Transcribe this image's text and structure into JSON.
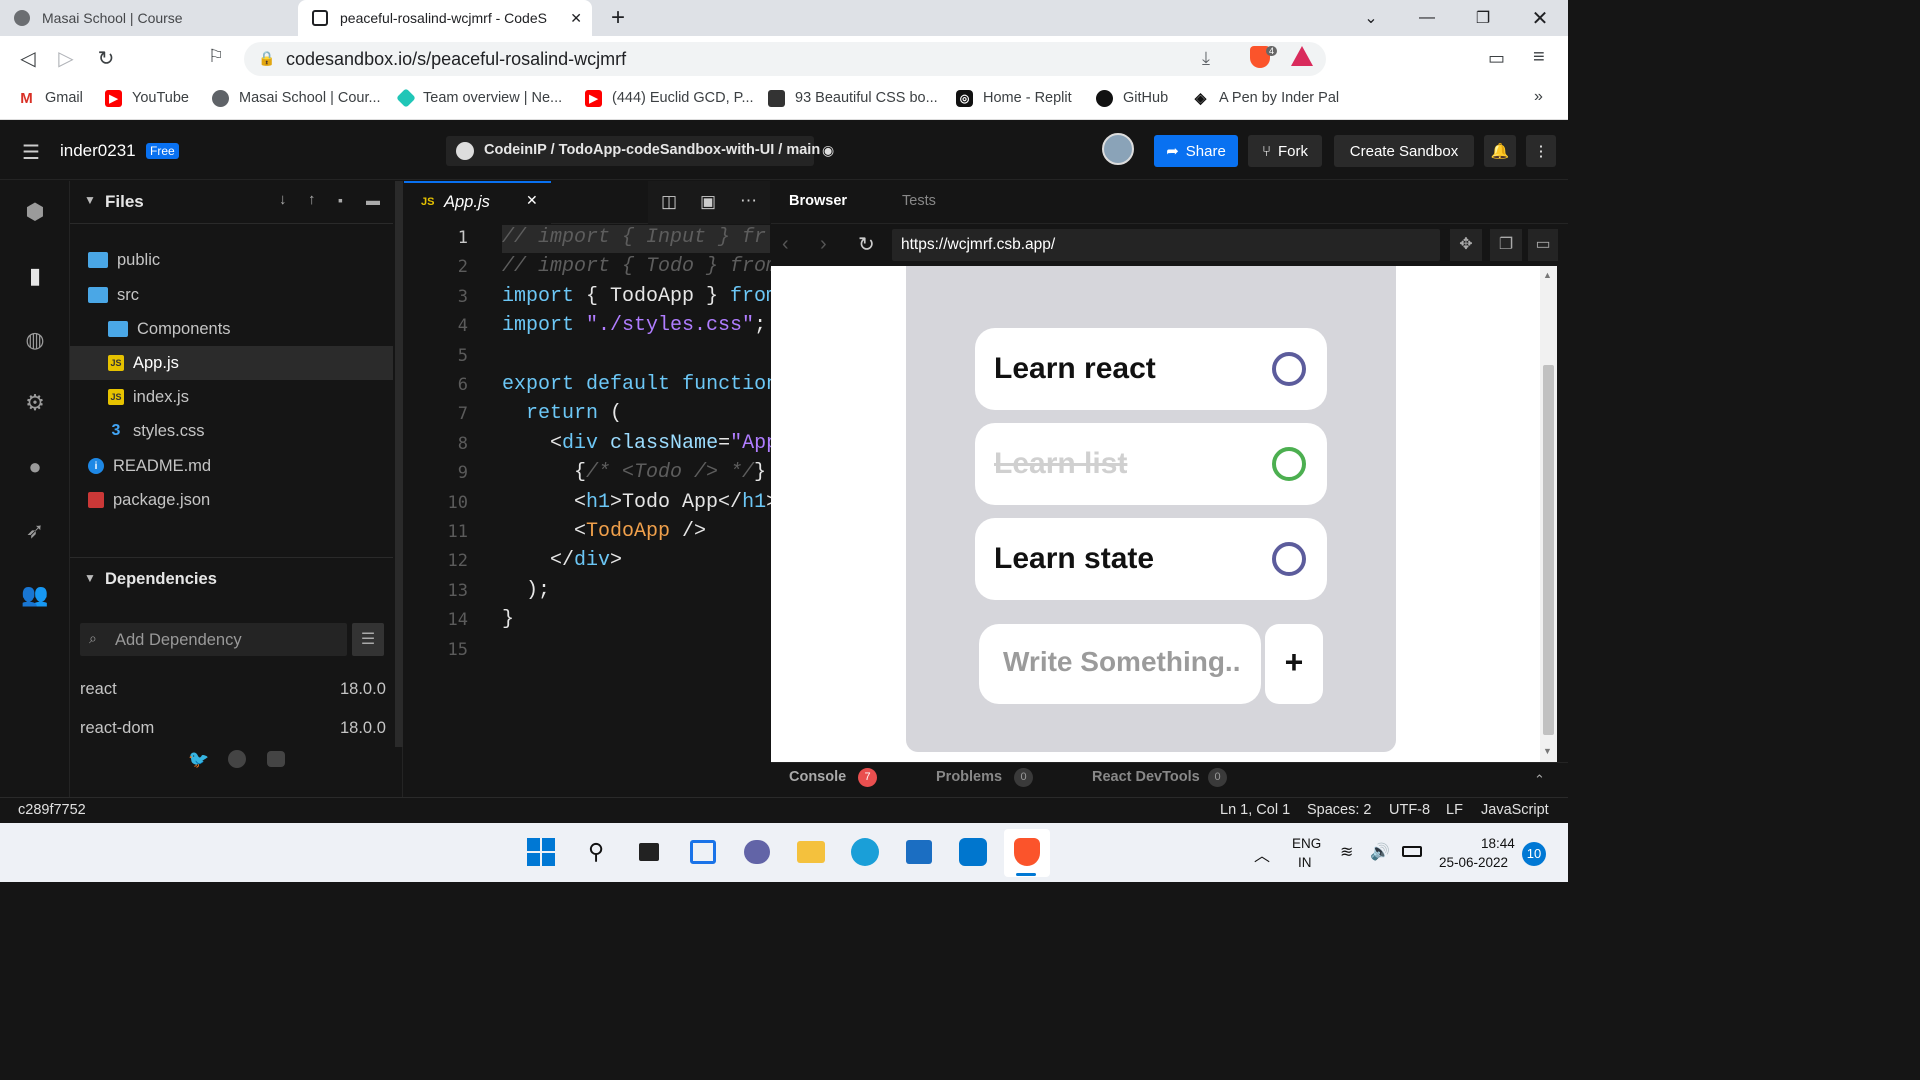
{
  "tabs": [
    {
      "title": "Masai School | Course",
      "active": false
    },
    {
      "title": "peaceful-rosalind-wcjmrf - CodeS",
      "active": true
    }
  ],
  "address_bar": {
    "url": "codesandbox.io/s/peaceful-rosalind-wcjmrf",
    "shield_count": "4"
  },
  "bookmarks": [
    {
      "label": "Gmail",
      "icon": "gmail-icon"
    },
    {
      "label": "YouTube",
      "icon": "youtube-icon"
    },
    {
      "label": "Masai School | Cour...",
      "icon": "globe-icon"
    },
    {
      "label": "Team overview | Ne...",
      "icon": "netlify-icon"
    },
    {
      "label": "(444) Euclid GCD, P...",
      "icon": "youtube-icon"
    },
    {
      "label": "93 Beautiful CSS bo...",
      "icon": "css-icon"
    },
    {
      "label": "Home - Replit",
      "icon": "replit-icon"
    },
    {
      "label": "GitHub",
      "icon": "github-icon"
    },
    {
      "label": "A Pen by Inder Pal",
      "icon": "codepen-icon"
    }
  ],
  "header": {
    "username": "inder0231",
    "plan_badge": "Free",
    "repo_path": "CodeinIP / TodoApp-codeSandbox-with-UI / main",
    "share_label": "Share",
    "fork_label": "Fork",
    "create_label": "Create Sandbox"
  },
  "explorer": {
    "title": "Files",
    "files": [
      {
        "name": "public",
        "type": "folder",
        "depth": 0
      },
      {
        "name": "src",
        "type": "folder-open",
        "depth": 0
      },
      {
        "name": "Components",
        "type": "folder",
        "depth": 1
      },
      {
        "name": "App.js",
        "type": "js",
        "depth": 1,
        "selected": true
      },
      {
        "name": "index.js",
        "type": "js",
        "depth": 1
      },
      {
        "name": "styles.css",
        "type": "css",
        "depth": 1
      },
      {
        "name": "README.md",
        "type": "info",
        "depth": 0
      },
      {
        "name": "package.json",
        "type": "npm",
        "depth": 0
      }
    ],
    "dependencies_title": "Dependencies",
    "add_dependency_placeholder": "Add Dependency",
    "dependencies": [
      {
        "name": "react",
        "version": "18.0.0"
      },
      {
        "name": "react-dom",
        "version": "18.0.0"
      }
    ]
  },
  "editor": {
    "tab_label": "App.js",
    "tab_badge": "JS",
    "lines": [
      "// import { Input } fr",
      "// import { Todo } from",
      "import { TodoApp } from",
      "import \"./styles.css\";",
      "",
      "export default function",
      "  return (",
      "    <div className=\"App",
      "      {/* <Todo /> */}",
      "      <h1>Todo App</h1>",
      "      <TodoApp />",
      "    </div>",
      "  );",
      "}",
      ""
    ],
    "line_numbers": [
      "1",
      "2",
      "3",
      "4",
      "5",
      "6",
      "7",
      "8",
      "9",
      "10",
      "11",
      "12",
      "13",
      "14",
      "15"
    ]
  },
  "browser": {
    "tab_browser": "Browser",
    "tab_tests": "Tests",
    "preview_url": "https://wcjmrf.csb.app/",
    "todos": [
      {
        "text": "Learn react",
        "done": false
      },
      {
        "text": "Learn list",
        "done": true
      },
      {
        "text": "Learn state",
        "done": false
      }
    ],
    "input_placeholder": "Write Something..",
    "add_button": "+"
  },
  "bottom_tabs": [
    {
      "label": "Console",
      "count": "7"
    },
    {
      "label": "Problems",
      "count": "0"
    },
    {
      "label": "React DevTools",
      "count": "0"
    }
  ],
  "status": {
    "commit": "c289f7752",
    "position": "Ln 1, Col 1",
    "spaces": "Spaces: 2",
    "encoding": "UTF-8",
    "eol": "LF",
    "language": "JavaScript"
  },
  "taskbar": {
    "lang_top": "ENG",
    "lang_bottom": "IN",
    "time": "18:44",
    "date": "25-06-2022",
    "notifications": "10"
  },
  "colors": {
    "accent_blue": "#0971f1",
    "ring_purple": "#5c5c9c",
    "ring_green": "#4caf50",
    "console_badge": "#e94f4f"
  }
}
